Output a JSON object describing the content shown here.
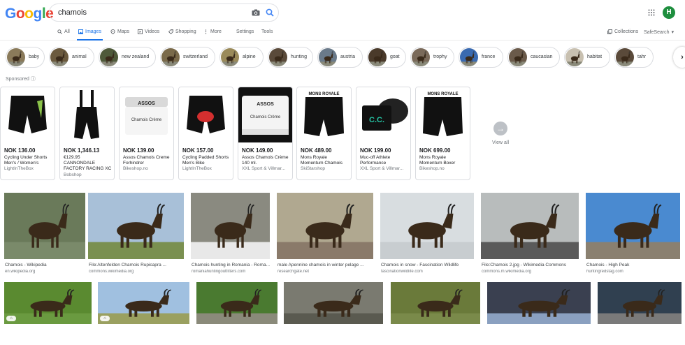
{
  "header": {
    "logo_letters": [
      {
        "ch": "G",
        "color": "#4285f4"
      },
      {
        "ch": "o",
        "color": "#ea4335"
      },
      {
        "ch": "o",
        "color": "#fbbc05"
      },
      {
        "ch": "g",
        "color": "#4285f4"
      },
      {
        "ch": "l",
        "color": "#34a853"
      },
      {
        "ch": "e",
        "color": "#ea4335"
      }
    ],
    "query": "chamois",
    "avatar_letter": "H"
  },
  "tabs": {
    "all": "All",
    "images": "Images",
    "maps": "Maps",
    "videos": "Videos",
    "shopping": "Shopping",
    "more": "More",
    "settings": "Settings",
    "tools": "Tools",
    "collections": "Collections",
    "safesearch": "SafeSearch"
  },
  "chips": [
    {
      "label": "baby"
    },
    {
      "label": "animal"
    },
    {
      "label": "new zealand"
    },
    {
      "label": "switzerland"
    },
    {
      "label": "alpine"
    },
    {
      "label": "hunting"
    },
    {
      "label": "austria"
    },
    {
      "label": "goat"
    },
    {
      "label": "trophy"
    },
    {
      "label": "france"
    },
    {
      "label": "caucasian"
    },
    {
      "label": "habitat"
    },
    {
      "label": "tahr"
    }
  ],
  "sponsored_label": "Sponsored",
  "products": [
    {
      "price": "NOK 136.00",
      "title": "Cycling Under Shorts Men's / Women's",
      "store": "LightInTheBox"
    },
    {
      "price": "NOK 1,346.13",
      "sub_price": "€129.95",
      "title": "CANNONDALE FACTORY RACING XC",
      "store": "Bobshop"
    },
    {
      "price": "NOK 139.00",
      "title": "Assos Chamois Creme Forhindrer",
      "store": "Bikeshop.no"
    },
    {
      "price": "NOK 157.00",
      "title": "Cycling Padded Shorts Men's Bike",
      "store": "LightInTheBox"
    },
    {
      "price": "NOK 149.00",
      "title": "Assos Chamois Crème 140 ml.",
      "store": "XXL Sport & Villmar..."
    },
    {
      "price": "NOK 489.00",
      "title": "Mons Royale Momentum Chamois",
      "store": "SkiStarshop"
    },
    {
      "price": "NOK 199.00",
      "title": "Muc-off Athlete Performance",
      "store": "XXL Sport & Villmar..."
    },
    {
      "price": "NOK 699.00",
      "title": "Mons Royale Momentum Boxer",
      "store": "Bikeshop.no"
    }
  ],
  "product_labels": {
    "assos_brand": "ASSOS",
    "assos_text": "Chamois Crème",
    "mons_brand": "MONS ROYALE",
    "muc_text": "C.C."
  },
  "view_all": "View all",
  "results_row1": [
    {
      "caption": "Chamois - Wikipedia",
      "source": "en.wikipedia.org"
    },
    {
      "caption": "File:Altenfelden Chamois Rupicapra ...",
      "source": "commons.wikimedia.org"
    },
    {
      "caption": "Chamois hunting in Romania - Roma...",
      "source": "romaniahuntingoutfitters.com"
    },
    {
      "caption": "male Apennine chamois in winter pelage ...",
      "source": "researchgate.net"
    },
    {
      "caption": "Chamois in snow - Fascination Wildlife",
      "source": "fascinationwildlife.com"
    },
    {
      "caption": "File:Chamois 2.jpg - Wikimedia Commons",
      "source": "commons.m.wikimedia.org"
    },
    {
      "caption": "Chamois - High Peak",
      "source": "huntingredstag.com"
    }
  ],
  "results_row2_count": 7
}
